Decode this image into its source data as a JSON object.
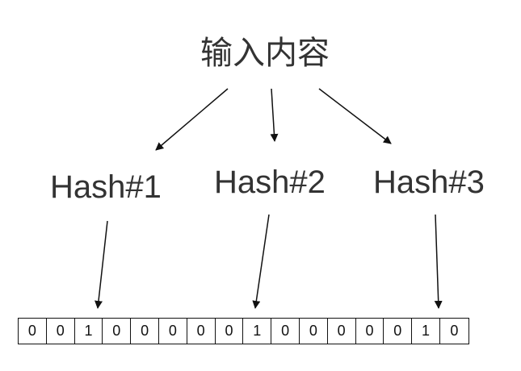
{
  "input": {
    "label": "输入内容"
  },
  "hashes": [
    {
      "label": "Hash#1"
    },
    {
      "label": "Hash#2"
    },
    {
      "label": "Hash#3"
    }
  ],
  "bit_array": [
    "0",
    "0",
    "1",
    "0",
    "0",
    "0",
    "0",
    "0",
    "1",
    "0",
    "0",
    "0",
    "0",
    "0",
    "1",
    "0"
  ]
}
